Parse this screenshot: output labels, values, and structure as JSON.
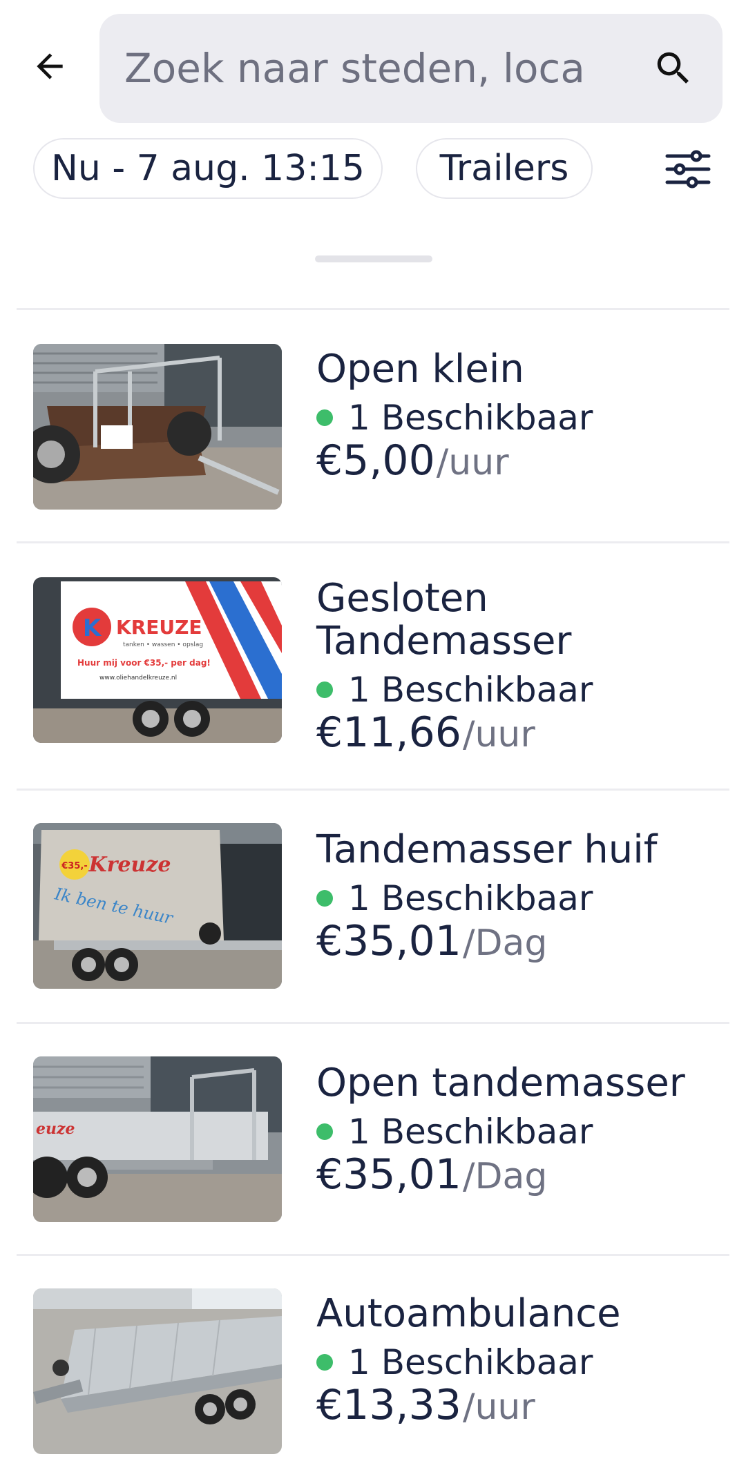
{
  "search": {
    "placeholder": "Zoek naar steden, loca",
    "back_icon": "arrow-left-icon",
    "search_icon": "search-icon"
  },
  "filters": {
    "date_chip": "Nu - 7 aug. 13:15",
    "type_chip": "Trailers",
    "filter_icon": "sliders-icon"
  },
  "colors": {
    "available_dot": "#3dbd6a",
    "text": "#1a2340",
    "muted": "#6f7283",
    "search_bg": "#ececf1"
  },
  "listings": [
    {
      "title": "Open klein",
      "availability": "1 Beschikbaar",
      "price": "€5,00",
      "unit": "/uur"
    },
    {
      "title": "Gesloten Tandemasser",
      "availability": "1 Beschikbaar",
      "price": "€11,66",
      "unit": "/uur"
    },
    {
      "title": "Tandemasser huif",
      "availability": "1 Beschikbaar",
      "price": "€35,01",
      "unit": "/Dag"
    },
    {
      "title": "Open tandemasser",
      "availability": "1 Beschikbaar",
      "price": "€35,01",
      "unit": "/Dag"
    },
    {
      "title": "Autoambulance",
      "availability": "1 Beschikbaar",
      "price": "€13,33",
      "unit": "/uur"
    }
  ],
  "images": {
    "thumb_2_logo": "KREUZE",
    "thumb_2_sub": "tanken • wassen • opslag",
    "thumb_2_promo": "Huur mij voor €35,- per dag!",
    "thumb_2_url": "www.oliehandelkreuze.nl",
    "thumb_3_brand": "Kreuze",
    "thumb_3_slogan": "Ik ben te huur",
    "thumb_3_badge": "€35,-"
  }
}
